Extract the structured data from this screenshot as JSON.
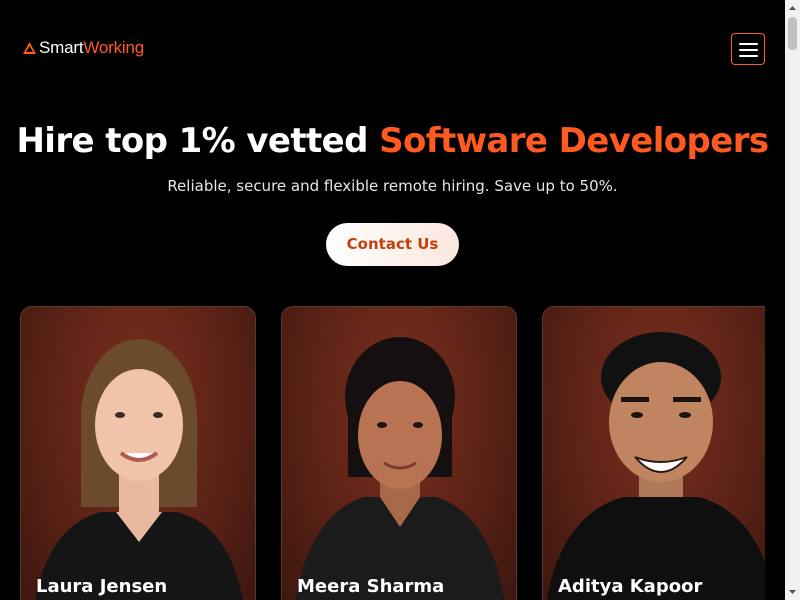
{
  "brand": {
    "name_part1": "Smart",
    "name_part2": "Working",
    "accent_color": "#ff5a1f"
  },
  "header": {
    "menu_icon": "hamburger-icon"
  },
  "hero": {
    "title_prefix": "Hire top 1% vetted ",
    "title_accent": "Software Developers",
    "subtitle": "Reliable, secure and flexible remote hiring. Save up to 50%.",
    "cta_label": "Contact Us"
  },
  "developers": [
    {
      "name": "Laura Jensen"
    },
    {
      "name": "Meera Sharma"
    },
    {
      "name": "Aditya Kapoor"
    }
  ]
}
